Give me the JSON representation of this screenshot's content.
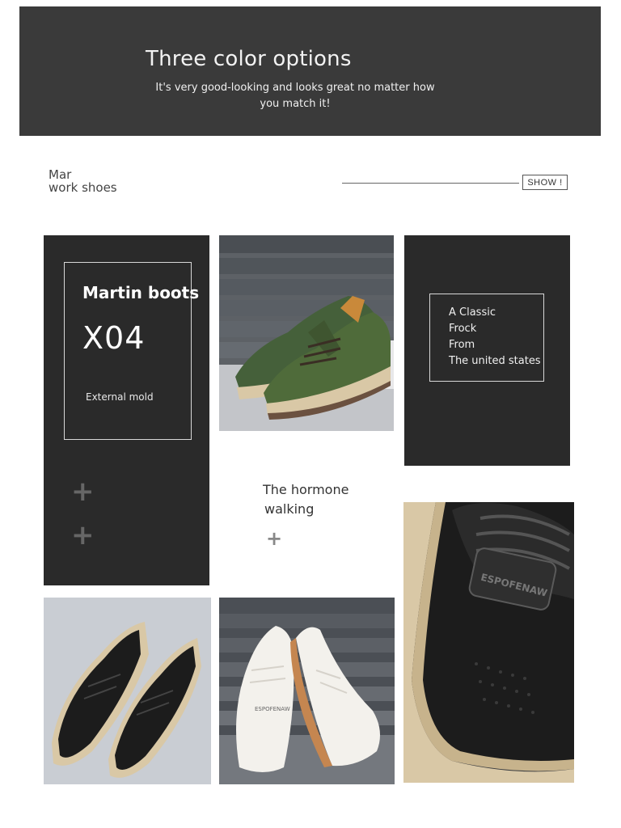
{
  "banner": {
    "title": "Three color options",
    "subtitle": "It's very good-looking and looks great no matter how you match it!"
  },
  "section": {
    "label_line1": "Mar",
    "label_line2": "work shoes",
    "show_button": "SHOW !"
  },
  "product_card": {
    "name": "Martin boots",
    "code": "X04",
    "detail": "External mold"
  },
  "classic_box": {
    "lines": [
      "A Classic",
      "Frock",
      "From",
      "The united states"
    ]
  },
  "hormone": {
    "line1": "The hormone",
    "line2": "walking"
  },
  "photos": {
    "closeup_brand_text": "ESPOFENAW",
    "white_shoe_tongue_text": "ESPOFENAW"
  },
  "colors": {
    "banner_bg": "#3a3a3a",
    "panel_bg": "#2a2a2a",
    "shoe_green": "#4f6b3a",
    "shoe_black": "#1c1c1c",
    "shoe_white": "#f3f1ec",
    "sole_tan": "#d9c8a6"
  },
  "icons": [
    "plus-icon"
  ]
}
